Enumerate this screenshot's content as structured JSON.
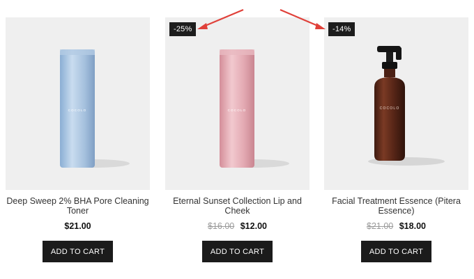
{
  "products": [
    {
      "title": "Deep Sweep 2% BHA Pore Cleaning Toner",
      "price": "$21.00",
      "old_price": "",
      "badge": "",
      "button": "ADD TO CART",
      "brand_mark": "COCOLO",
      "bottle_color": "#a9c4e0"
    },
    {
      "title": "Eternal Sunset Collection Lip and Cheek",
      "price": "$12.00",
      "old_price": "$16.00",
      "badge": "-25%",
      "button": "ADD TO CART",
      "brand_mark": "COCOLO",
      "bottle_color": "#e2a8b0"
    },
    {
      "title": "Facial Treatment Essence (Pitera Essence)",
      "price": "$18.00",
      "old_price": "$21.00",
      "badge": "-14%",
      "button": "ADD TO CART",
      "brand_mark": "COCOLO",
      "bottle_color": "#6a2e1c"
    }
  ],
  "annotation": {
    "arrow_color": "#e0413a"
  }
}
